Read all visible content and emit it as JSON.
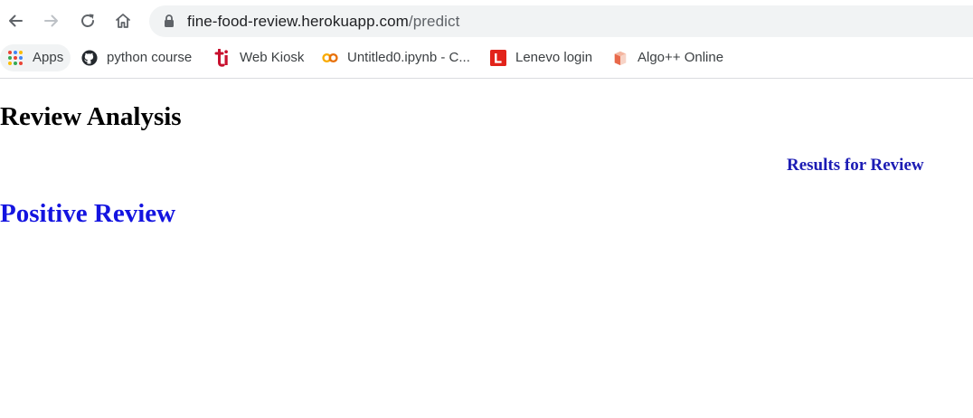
{
  "browser": {
    "url_host": "fine-food-review.herokuapp.com",
    "url_path": "/predict",
    "icons": {
      "back": "arrow-left-icon",
      "forward": "arrow-right-icon",
      "reload": "reload-icon",
      "home": "home-icon",
      "lock": "lock-icon"
    }
  },
  "bookmarks": [
    {
      "label": "Apps",
      "icon": "apps-grid-icon"
    },
    {
      "label": "python course",
      "icon": "github-icon"
    },
    {
      "label": "Web Kiosk",
      "icon": "ti-logo-icon"
    },
    {
      "label": "Untitled0.ipynb - C...",
      "icon": "colab-icon"
    },
    {
      "label": "Lenevo login",
      "icon": "l-logo-icon"
    },
    {
      "label": "Algo++ Online",
      "icon": "cube-icon"
    }
  ],
  "page": {
    "title": "Review Analysis",
    "results_heading": "Results for Review",
    "result": "Positive Review"
  },
  "colors": {
    "result_color": "#1414e0",
    "heading_color": "#1c1cb4"
  }
}
